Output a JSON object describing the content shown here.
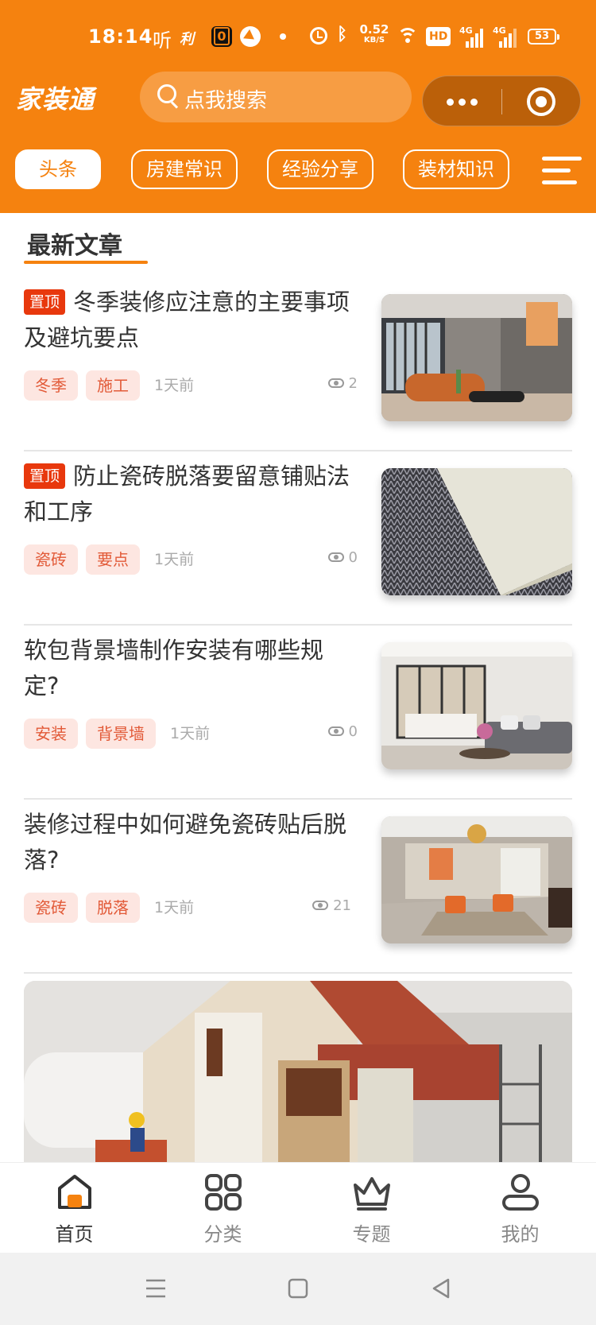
{
  "status_bar": {
    "time": "18:14",
    "icon_ting": "听",
    "icon_app1": "利",
    "icon_app2": "0",
    "net_speed": "0.52",
    "net_unit": "KB/S",
    "hd": "HD",
    "signal1": "4G",
    "signal2": "4G",
    "battery": "53"
  },
  "header": {
    "logo": "家装通",
    "search_placeholder": "点我搜索",
    "tabs": [
      {
        "label": "头条",
        "active": true
      },
      {
        "label": "房建常识",
        "active": false
      },
      {
        "label": "经验分享",
        "active": false
      },
      {
        "label": "装材知识",
        "active": false
      }
    ]
  },
  "section": {
    "title": "最新文章"
  },
  "articles": [
    {
      "pinned": true,
      "pin_label": "置顶",
      "title": "冬季装修应注意的主要事项及避坑要点",
      "tags": [
        "冬季",
        "施工"
      ],
      "time": "1天前",
      "views": "2"
    },
    {
      "pinned": true,
      "pin_label": "置顶",
      "title": "防止瓷砖脱落要留意铺贴法和工序",
      "tags": [
        "瓷砖",
        "要点"
      ],
      "time": "1天前",
      "views": "0"
    },
    {
      "pinned": false,
      "title": "软包背景墙制作安装有哪些规定?",
      "tags": [
        "安装",
        "背景墙"
      ],
      "time": "1天前",
      "views": "0"
    },
    {
      "pinned": false,
      "title": "装修过程中如何避免瓷砖贴后脱落?",
      "tags": [
        "瓷砖",
        "脱落"
      ],
      "time": "1天前",
      "views": "21"
    }
  ],
  "bottom_nav": [
    {
      "label": "首页",
      "icon": "home-icon",
      "active": true
    },
    {
      "label": "分类",
      "icon": "category-grid-icon",
      "active": false
    },
    {
      "label": "专题",
      "icon": "crown-icon",
      "active": false
    },
    {
      "label": "我的",
      "icon": "user-icon",
      "active": false
    }
  ],
  "colors": {
    "brand": "#f5820f",
    "pin": "#e8380d",
    "tag_bg": "#fde6e1",
    "tag_text": "#e25a38"
  }
}
